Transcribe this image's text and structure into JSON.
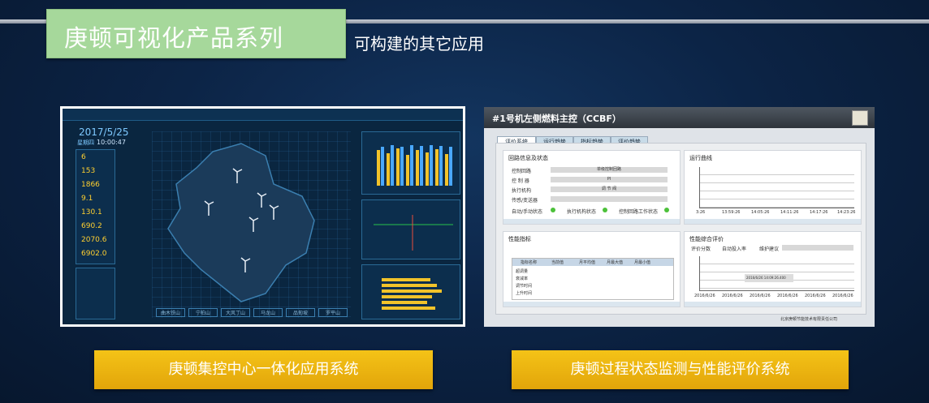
{
  "header": {
    "title": "庚顿可视化产品系列",
    "subtitle": "可构建的其它应用"
  },
  "screenshot1": {
    "date": "2017/5/25",
    "weekday": "星期四",
    "time": "10:00:47",
    "values": [
      "6",
      "153",
      "1866",
      "9.1",
      "130.1",
      "690.2",
      "2070.6",
      "6902.0"
    ],
    "bottom_buttons": [
      "曲木铁山",
      "宁柏山",
      "大风丁山",
      "马龙山",
      "品甸坡",
      "罗平山"
    ]
  },
  "screenshot2": {
    "title": "#1号机左侧燃料主控（CCBF）",
    "tabs": [
      "评价系统",
      "运行趋势",
      "指标趋势",
      "评价趋势"
    ],
    "cards": {
      "loop": "回路信息及状态",
      "curve": "运行曲线",
      "perf": "性能指标",
      "overall": "性能综合评价"
    },
    "loop_rows": [
      {
        "label": "控制回路",
        "value": "单级控制回路"
      },
      {
        "label": "控 制 器",
        "value": "PI"
      },
      {
        "label": "执行机构",
        "value": "调 节 阀"
      },
      {
        "label": "传感/变送器",
        "value": ""
      }
    ],
    "status_labels": [
      "自动/手动状态",
      "执行机构状态",
      "控制回路工作状态"
    ],
    "perf_headers": [
      "指标名称",
      "当前值",
      "月平均值",
      "月最大值",
      "月最小值"
    ],
    "perf_rows": [
      "超调量",
      "衰减率",
      "调节时间",
      "上升时间"
    ],
    "overall_labels": [
      "评价分数",
      "自动投入率",
      "维护建议"
    ],
    "curve_times": [
      "3:26",
      "13:59:26",
      "14:05:26",
      "14:11:26",
      "14:17:26",
      "14:23:26"
    ],
    "overall_dates": [
      "2016/6/26",
      "2016/6/26",
      "2016/6/26",
      "2016/6/26",
      "2016/6/26",
      "2016/6/26"
    ],
    "tooltip": "2016/6/26 14:09:26.400",
    "footer": "北京庚顿节能技术有限责任公司"
  },
  "buttons": {
    "left": "庚顿集控中心一体化应用系统",
    "right": "庚顿过程状态监测与性能评价系统"
  },
  "colors": {
    "title_bg": "#a6d89b",
    "button": "#f0b811",
    "page_bg": "#0c2446"
  }
}
